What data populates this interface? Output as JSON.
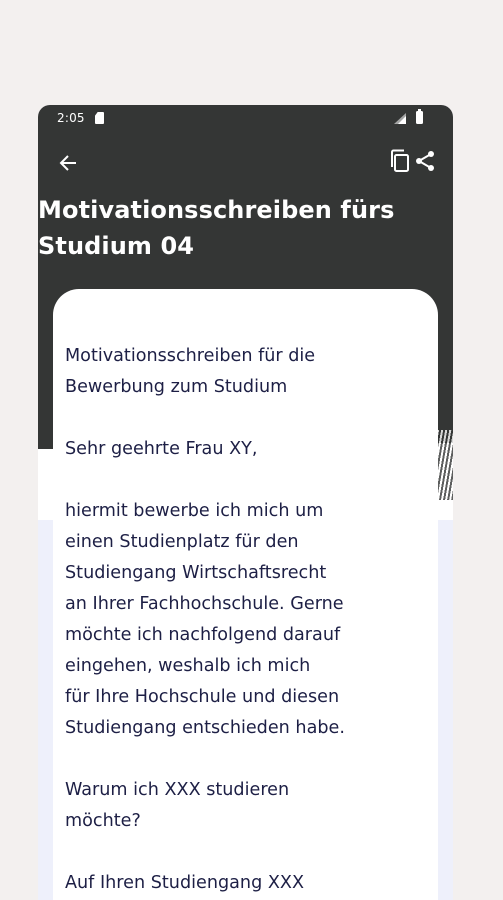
{
  "status_bar": {
    "time": "2:05",
    "icons": [
      "sd-card-icon",
      "signal-icon",
      "battery-icon"
    ]
  },
  "toolbar": {
    "back_icon": "arrow-left-icon",
    "copy_icon": "copy-icon",
    "share_icon": "share-icon"
  },
  "page": {
    "title": "Motivationsschreiben fürs\nStudium 04"
  },
  "letter": {
    "paragraphs": [
      "Motivationsschreiben für die\nBewerbung zum Studium",
      "Sehr geehrte Frau XY,",
      "hiermit bewerbe ich mich um\neinen Studienplatz für den\nStudiengang Wirtschaftsrecht\nan Ihrer Fachhochschule. Gerne\nmöchte ich nachfolgend darauf\neingehen, weshalb ich mich\nfür Ihre Hochschule und diesen\nStudiengang entschieden habe.",
      "Warum ich XXX studieren\nmöchte?",
      "Auf Ihren Studiengang XXX"
    ]
  },
  "colors": {
    "page_background": "#f3f0ef",
    "header_background": "#343635",
    "card_background": "#ffffff",
    "text_color": "#1d1f45"
  }
}
